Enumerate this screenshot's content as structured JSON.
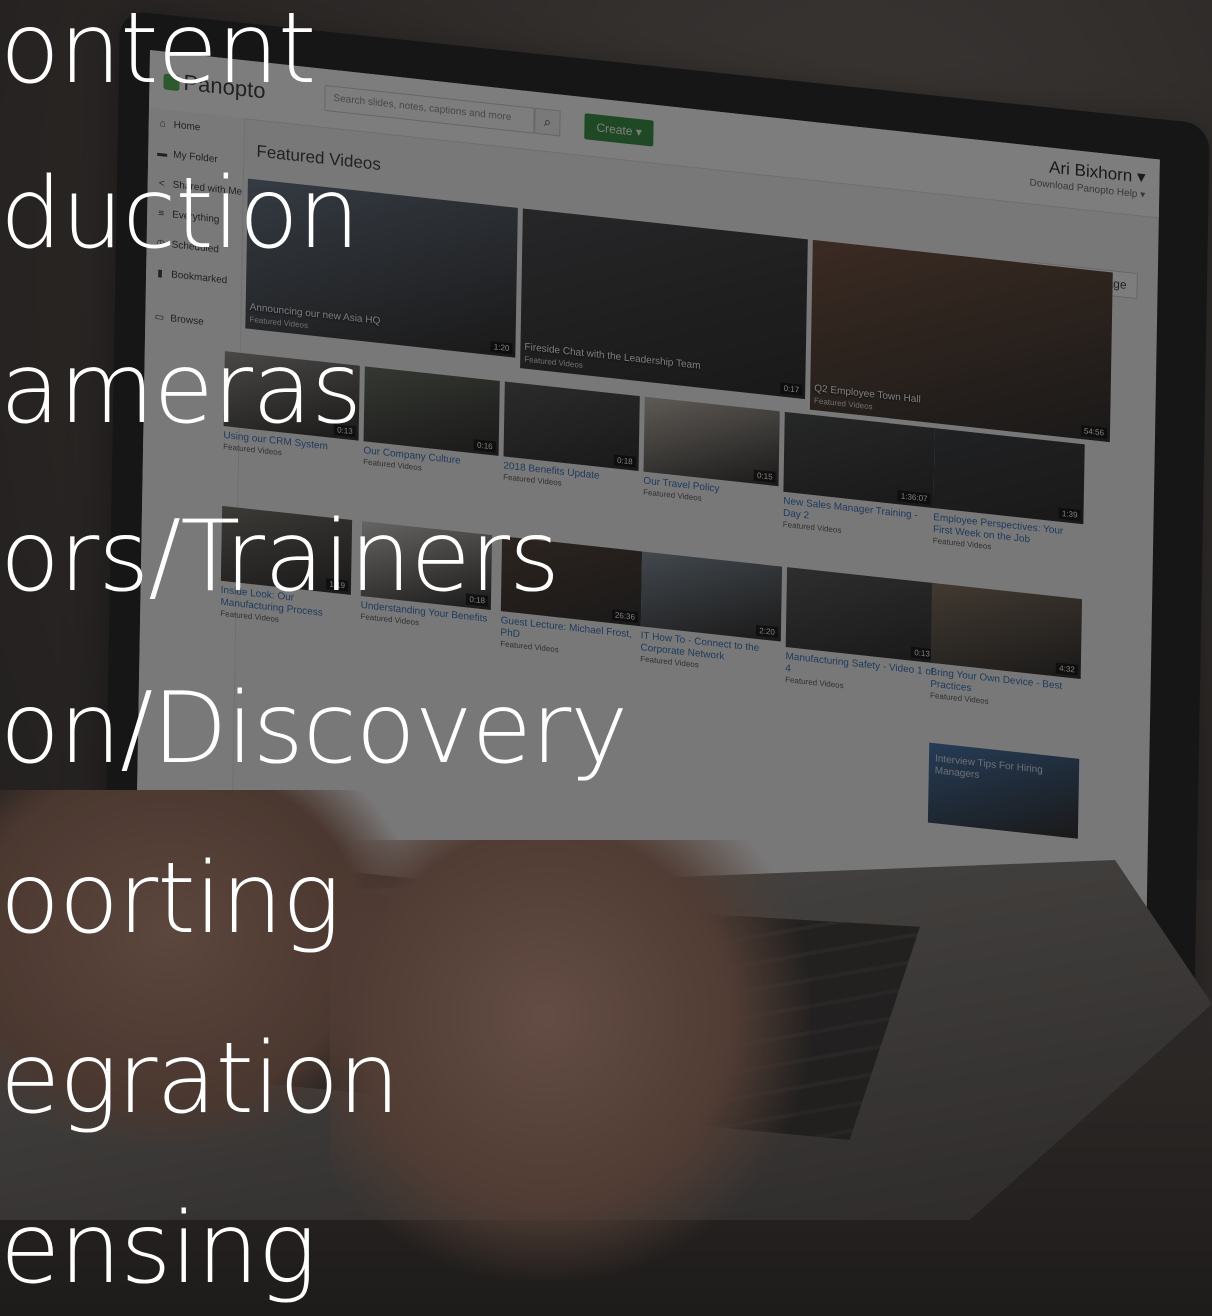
{
  "app": {
    "logo_text": "Panopto",
    "search_placeholder": "Search slides, notes, captions and more",
    "create_label": "Create ▾",
    "user_name": "Ari Bixhorn ▾",
    "user_links": "Download Panopto   Help ▾",
    "edit_page_label": "✎ Edit this page",
    "section_title": "Featured Videos"
  },
  "sidebar": {
    "items": [
      {
        "icon": "home-icon",
        "label": "Home"
      },
      {
        "icon": "folder-icon",
        "label": "My Folder"
      },
      {
        "icon": "share-icon",
        "label": "Shared with Me"
      },
      {
        "icon": "list-icon",
        "label": "Everything"
      },
      {
        "icon": "clock-icon",
        "label": "Scheduled"
      },
      {
        "icon": "bookmark-icon",
        "label": "Bookmarked"
      },
      {
        "icon": "browse-icon",
        "label": "Browse"
      }
    ]
  },
  "videos": [
    {
      "title": "Announcing our new Asia HQ",
      "sub": "Featured Videos",
      "duration": "1:20"
    },
    {
      "title": "Fireside Chat with the Leadership Team",
      "sub": "Featured Videos",
      "duration": "0:17"
    },
    {
      "title": "Q2 Employee Town Hall",
      "sub": "Featured Videos",
      "duration": "54:56"
    },
    {
      "title": "Using our CRM System",
      "sub": "Featured Videos",
      "duration": "0:13"
    },
    {
      "title": "Our Company Culture",
      "sub": "Featured Videos",
      "duration": "0:16"
    },
    {
      "title": "2018 Benefits Update",
      "sub": "Featured Videos",
      "duration": "0:18"
    },
    {
      "title": "Our Travel Policy",
      "sub": "Featured Videos",
      "duration": "0:15"
    },
    {
      "title": "New Sales Manager Training - Day 2",
      "sub": "Featured Videos",
      "duration": "1:36:07"
    },
    {
      "title": "Employee Perspectives: Your First Week on the Job",
      "sub": "Featured Videos",
      "duration": "1:39"
    },
    {
      "title": "Inside Look: Our Manufacturing Process",
      "sub": "Featured Videos",
      "duration": "1:19"
    },
    {
      "title": "Understanding Your Benefits",
      "sub": "Featured Videos",
      "duration": "0:18"
    },
    {
      "title": "Guest Lecture: Michael Frost, PhD",
      "sub": "Featured Videos",
      "duration": "26:36"
    },
    {
      "title": "IT How To - Connect to the Corporate Network",
      "sub": "Featured Videos",
      "duration": "2:20"
    },
    {
      "title": "Manufacturing Safety - Video 1 of 4",
      "sub": "Featured Videos",
      "duration": "0:13"
    },
    {
      "title": "Bring Your Own Device - Best Practices",
      "sub": "Featured Videos",
      "duration": "4:32"
    },
    {
      "title": "Interview Tips For Hiring Managers",
      "sub": "",
      "duration": ""
    }
  ],
  "overlay_lines": [
    "ontent",
    "duction",
    "ameras",
    "ors/Trainers",
    "on/Discovery",
    "oorting",
    "egration",
    "ensing"
  ]
}
